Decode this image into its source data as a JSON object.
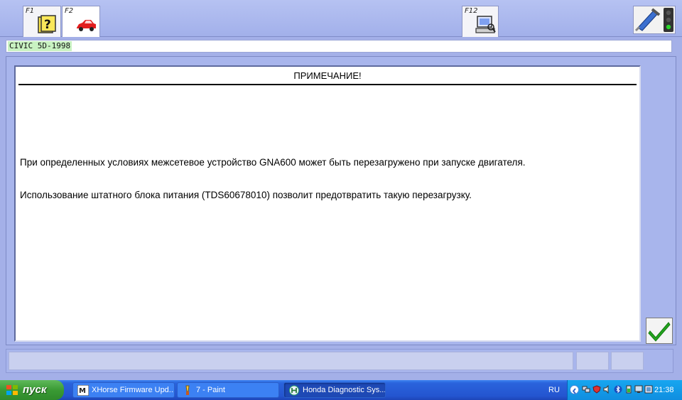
{
  "toolbar": {
    "f1_label": "F1",
    "f2_label": "F2",
    "f12_label": "F12"
  },
  "vehicle": {
    "model": "CIVIC 5D-1998"
  },
  "note": {
    "title": "ПРИМЕЧАНИЕ!",
    "paragraph_1": "При определенных условиях межсетевое устройство GNA600 может быть перезагружено при запуске двигателя.",
    "paragraph_2": "Использование штатного блока питания (TDS60678010) позволит предотвратить такую перезагрузку."
  },
  "taskbar": {
    "start_label": "пуск",
    "tasks": [
      {
        "label": "XHorse Firmware Upd...",
        "icon": "xhorse-app-icon"
      },
      {
        "label": "7 - Paint",
        "icon": "paint-icon"
      },
      {
        "label": "Honda Diagnostic Sys...",
        "icon": "honda-diagnostic-icon"
      }
    ],
    "language": "RU",
    "clock": "21:38"
  },
  "colors": {
    "app_background": "#a4b0e8",
    "vehicle_highlight": "#c9f2c2",
    "taskbar_blue": "#2455d0",
    "start_green": "#3a9a34",
    "confirm_green": "#22a41e"
  }
}
